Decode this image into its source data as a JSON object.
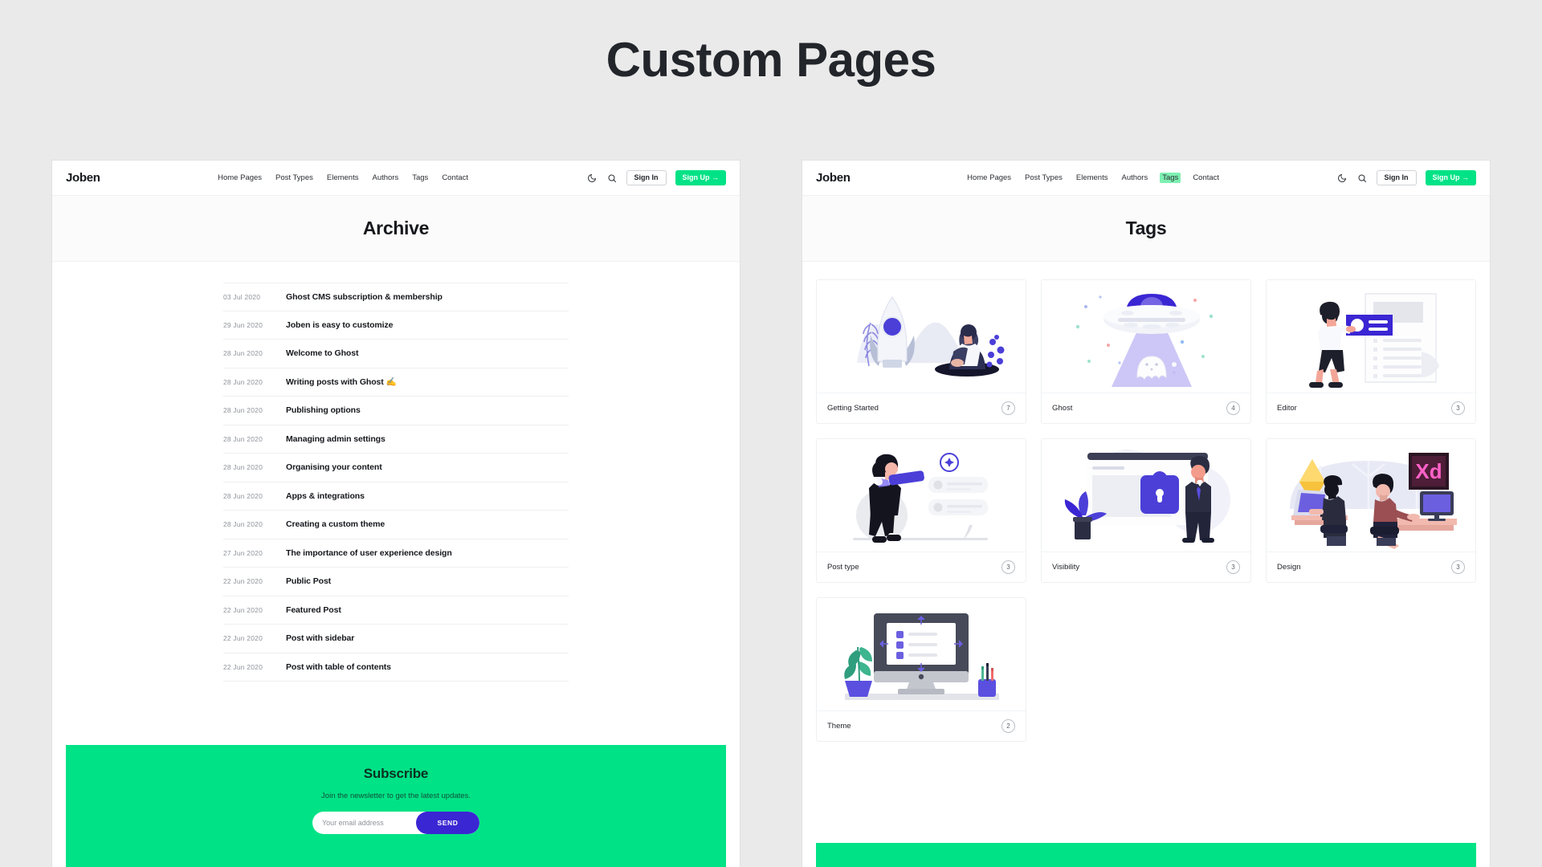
{
  "page": {
    "title": "Custom Pages"
  },
  "brand": "Joben",
  "nav": {
    "items": [
      {
        "label": "Home Pages",
        "active_left": false,
        "active_right": false
      },
      {
        "label": "Post Types",
        "active_left": false,
        "active_right": false
      },
      {
        "label": "Elements",
        "active_left": false,
        "active_right": false
      },
      {
        "label": "Authors",
        "active_left": false,
        "active_right": false
      },
      {
        "label": "Tags",
        "active_left": false,
        "active_right": true
      },
      {
        "label": "Contact",
        "active_left": false,
        "active_right": false
      }
    ],
    "dark_mode_icon": "moon-icon",
    "search_icon": "search-icon",
    "signin_label": "Sign In",
    "signup_label": "Sign Up →"
  },
  "left_panel": {
    "heading": "Archive",
    "rows": [
      {
        "date": "03 Jul 2020",
        "title": "Ghost CMS subscription & membership"
      },
      {
        "date": "29 Jun 2020",
        "title": "Joben is easy to customize"
      },
      {
        "date": "28 Jun 2020",
        "title": "Welcome to Ghost"
      },
      {
        "date": "28 Jun 2020",
        "title": "Writing posts with Ghost ✍️"
      },
      {
        "date": "28 Jun 2020",
        "title": "Publishing options"
      },
      {
        "date": "28 Jun 2020",
        "title": "Managing admin settings"
      },
      {
        "date": "28 Jun 2020",
        "title": "Organising your content"
      },
      {
        "date": "28 Jun 2020",
        "title": "Apps & integrations"
      },
      {
        "date": "28 Jun 2020",
        "title": "Creating a custom theme"
      },
      {
        "date": "27 Jun 2020",
        "title": "The importance of user experience design"
      },
      {
        "date": "22 Jun 2020",
        "title": "Public Post"
      },
      {
        "date": "22 Jun 2020",
        "title": "Featured Post"
      },
      {
        "date": "22 Jun 2020",
        "title": "Post with sidebar"
      },
      {
        "date": "22 Jun 2020",
        "title": "Post with table of contents"
      }
    ],
    "subscribe": {
      "title": "Subscribe",
      "subtitle": "Join the newsletter to get the latest updates.",
      "placeholder": "Your email address",
      "value": "",
      "button": "SEND"
    }
  },
  "right_panel": {
    "heading": "Tags",
    "tags": [
      {
        "name": "Getting Started",
        "count": "7",
        "art": "rocket-illustration"
      },
      {
        "name": "Ghost",
        "count": "4",
        "art": "ufo-ghost-illustration"
      },
      {
        "name": "Editor",
        "count": "3",
        "art": "editor-illustration"
      },
      {
        "name": "Post type",
        "count": "3",
        "art": "telescope-list-illustration"
      },
      {
        "name": "Visibility",
        "count": "3",
        "art": "lock-screen-illustration"
      },
      {
        "name": "Design",
        "count": "3",
        "art": "designers-illustration"
      },
      {
        "name": "Theme",
        "count": "2",
        "art": "desktop-monitor-illustration"
      }
    ]
  },
  "colors": {
    "accent_green": "#00e286",
    "accent_purple": "#3b26d3",
    "page_bg": "#eaeaea",
    "panel_bg": "#ffffff"
  }
}
